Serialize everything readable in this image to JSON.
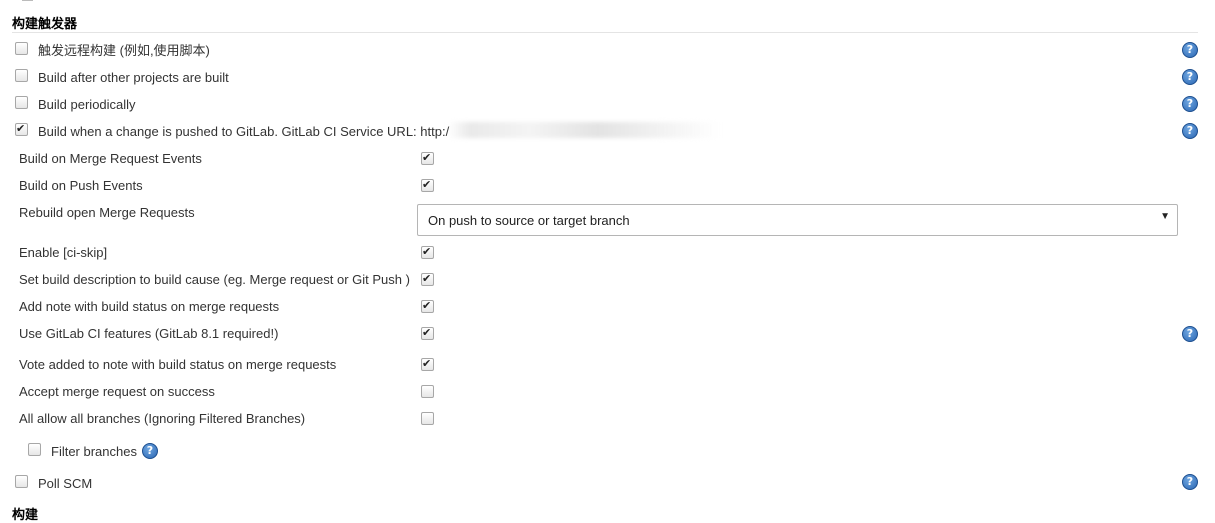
{
  "sections": {
    "triggers_title": "构建触发器",
    "build_title": "构建"
  },
  "triggers": [
    {
      "label": "触发远程构建 (例如,使用脚本)",
      "checked": false
    },
    {
      "label": "Build after other projects are built",
      "checked": false
    },
    {
      "label": "Build periodically",
      "checked": false
    },
    {
      "label": "Build when a change is pushed to GitLab. GitLab CI Service URL: http:/",
      "checked": true
    }
  ],
  "gitlab_options": {
    "merge_request_events": {
      "label": "Build on Merge Request Events",
      "checked": true
    },
    "push_events": {
      "label": "Build on Push Events",
      "checked": true
    },
    "rebuild_open_mr": {
      "label": "Rebuild open Merge Requests",
      "selected": "On push to source or target branch"
    },
    "ci_skip": {
      "label": "Enable [ci-skip]",
      "checked": true
    },
    "set_build_description": {
      "label": "Set build description to build cause (eg. Merge request or Git Push )",
      "checked": true
    },
    "add_note": {
      "label": "Add note with build status on merge requests",
      "checked": true
    },
    "ci_features": {
      "label": "Use GitLab CI features (GitLab 8.1 required!)",
      "checked": true
    },
    "vote_note": {
      "label": "Vote added to note with build status on merge requests",
      "checked": true
    },
    "accept_mr": {
      "label": "Accept merge request on success",
      "checked": false
    },
    "allow_all_branches": {
      "label": "All allow all branches (Ignoring Filtered Branches)",
      "checked": false
    },
    "filter_branches": {
      "label": "Filter branches",
      "checked": false
    }
  },
  "poll_scm": {
    "label": "Poll SCM",
    "checked": false
  },
  "help_glyph": "?",
  "checkmark_glyph": "✔",
  "dropdown_arrow": "▼",
  "icons": {
    "help": "help-circle-icon",
    "check": "checkmark-icon",
    "arrow": "chevron-down-icon"
  },
  "colors": {
    "help_blue": "#2a66b3",
    "text": "#333333"
  }
}
